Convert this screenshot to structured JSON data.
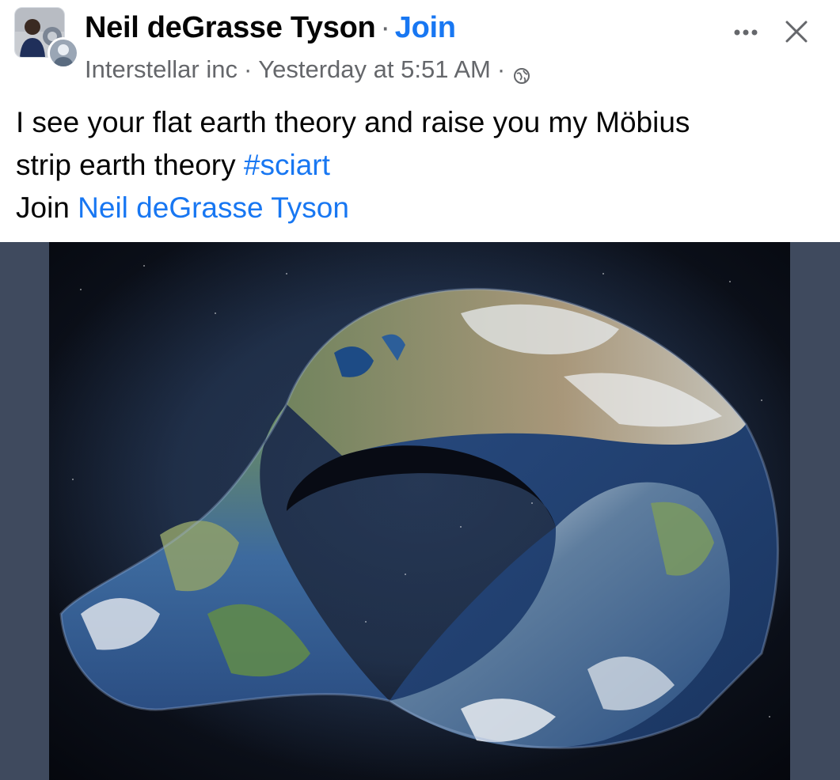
{
  "post": {
    "author": "Neil deGrasse Tyson",
    "separator": "·",
    "join_label": "Join",
    "group_name": "Interstellar inc",
    "timestamp": "Yesterday at 5:51 AM",
    "meta_separator": "·",
    "privacy_icon": "globe-icon",
    "more_icon": "more-horizontal-icon",
    "close_icon": "close-icon",
    "text_line1": "I see your flat earth theory and raise you my Möbius",
    "text_line2_plain": "strip earth theory ",
    "hashtag": "#sciart",
    "join_prefix": "Join ",
    "join_mention": "Neil deGrasse Tyson"
  },
  "colors": {
    "link": "#1877f2",
    "primary_text": "#050505",
    "secondary_text": "#65676b",
    "media_background": "#3f4a5e",
    "space": "#0b0f1a"
  }
}
